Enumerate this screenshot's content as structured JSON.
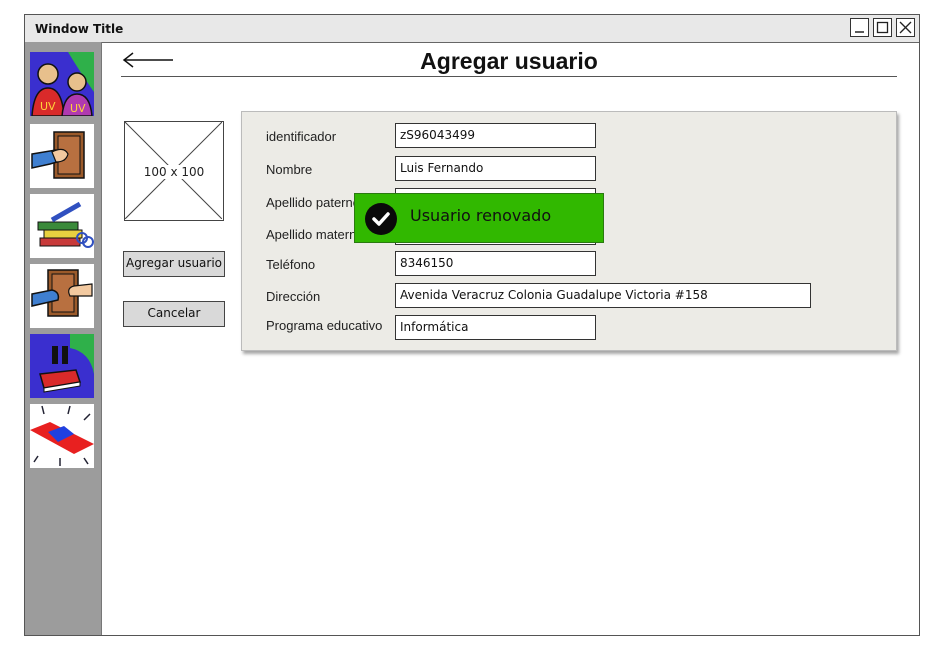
{
  "window": {
    "title": "Window Title",
    "controls": [
      "minimize-icon",
      "maximize-icon",
      "close-icon"
    ]
  },
  "sidebar": {
    "items": [
      {
        "name": "users-icon"
      },
      {
        "name": "book-hand-icon"
      },
      {
        "name": "books-pencil-icon"
      },
      {
        "name": "book-exchange-icon"
      },
      {
        "name": "book-pause-icon"
      },
      {
        "name": "alarm-light-icon"
      }
    ]
  },
  "header": {
    "back_icon": "back-arrow-icon",
    "title": "Agregar usuario"
  },
  "image_placeholder": {
    "label": "100 x 100"
  },
  "actions": {
    "add_label": "Agregar usuario",
    "cancel_label": "Cancelar"
  },
  "form": {
    "fields": [
      {
        "label": "identificador",
        "value": "zS96043499"
      },
      {
        "label": "Nombre",
        "value": "Luis Fernando"
      },
      {
        "label": "Apellido paterno",
        "value": ""
      },
      {
        "label": "Apellido materno",
        "value": ""
      },
      {
        "label": "Teléfono",
        "value": "8346150"
      },
      {
        "label": "Dirección",
        "value": "Avenida Veracruz Colonia Guadalupe Victoria #158"
      },
      {
        "label": "Programa educativo",
        "value": "Informática"
      }
    ]
  },
  "toast": {
    "icon": "check-circle-icon",
    "message": "Usuario renovado",
    "color": "#31b800"
  }
}
